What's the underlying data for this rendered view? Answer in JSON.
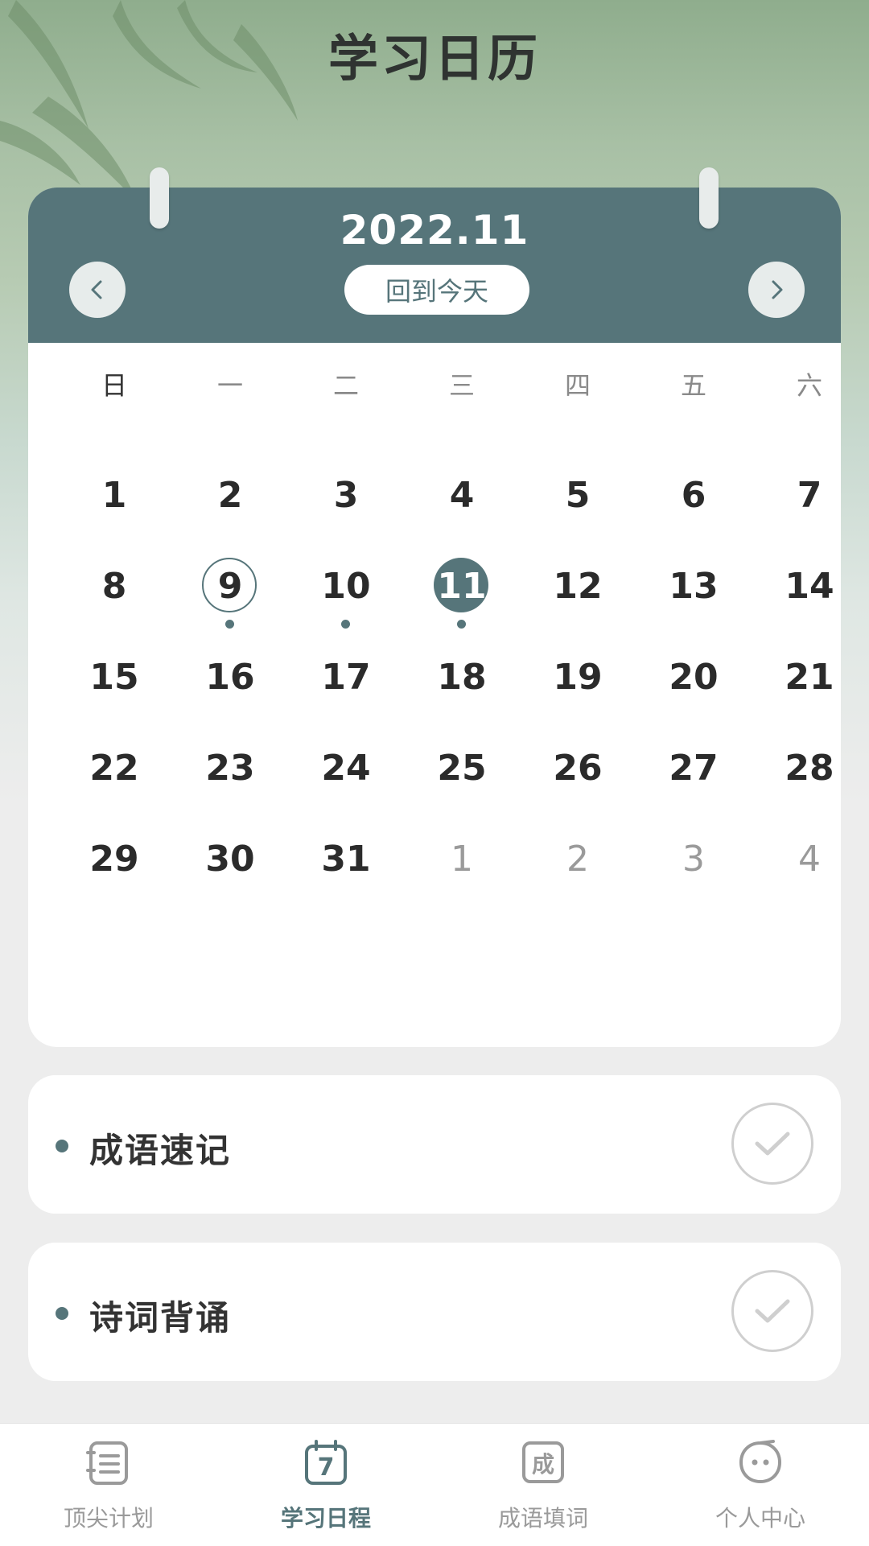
{
  "page": {
    "title": "学习日历"
  },
  "calendar": {
    "month_label": "2022.11",
    "today_button": "回到今天",
    "weekdays": [
      "日",
      "一",
      "二",
      "三",
      "四",
      "五",
      "六"
    ],
    "weeks": [
      [
        {
          "d": "1"
        },
        {
          "d": "2"
        },
        {
          "d": "3"
        },
        {
          "d": "4"
        },
        {
          "d": "5"
        },
        {
          "d": "6"
        },
        {
          "d": "7"
        }
      ],
      [
        {
          "d": "8"
        },
        {
          "d": "9",
          "selected": true,
          "dot": true
        },
        {
          "d": "10",
          "dot": true
        },
        {
          "d": "11",
          "today": true,
          "dot": true
        },
        {
          "d": "12"
        },
        {
          "d": "13"
        },
        {
          "d": "14"
        }
      ],
      [
        {
          "d": "15"
        },
        {
          "d": "16"
        },
        {
          "d": "17"
        },
        {
          "d": "18"
        },
        {
          "d": "19"
        },
        {
          "d": "20"
        },
        {
          "d": "21"
        }
      ],
      [
        {
          "d": "22"
        },
        {
          "d": "23"
        },
        {
          "d": "24"
        },
        {
          "d": "25"
        },
        {
          "d": "26"
        },
        {
          "d": "27"
        },
        {
          "d": "28"
        }
      ],
      [
        {
          "d": "29"
        },
        {
          "d": "30"
        },
        {
          "d": "31"
        },
        {
          "d": "1",
          "muted": true
        },
        {
          "d": "2",
          "muted": true
        },
        {
          "d": "3",
          "muted": true
        },
        {
          "d": "4",
          "muted": true
        }
      ]
    ],
    "accent_color": "#56757a"
  },
  "tasks": [
    {
      "label": "成语速记",
      "done": false
    },
    {
      "label": "诗词背诵",
      "done": false
    }
  ],
  "tabbar": {
    "tabs": [
      {
        "label": "顶尖计划",
        "icon": "plan-list-icon",
        "active": false
      },
      {
        "label": "学习日程",
        "icon": "calendar-7-icon",
        "glyph": "7",
        "active": true
      },
      {
        "label": "成语填词",
        "icon": "idiom-cheng-icon",
        "glyph": "成",
        "active": false
      },
      {
        "label": "个人中心",
        "icon": "profile-face-icon",
        "active": false
      }
    ]
  }
}
